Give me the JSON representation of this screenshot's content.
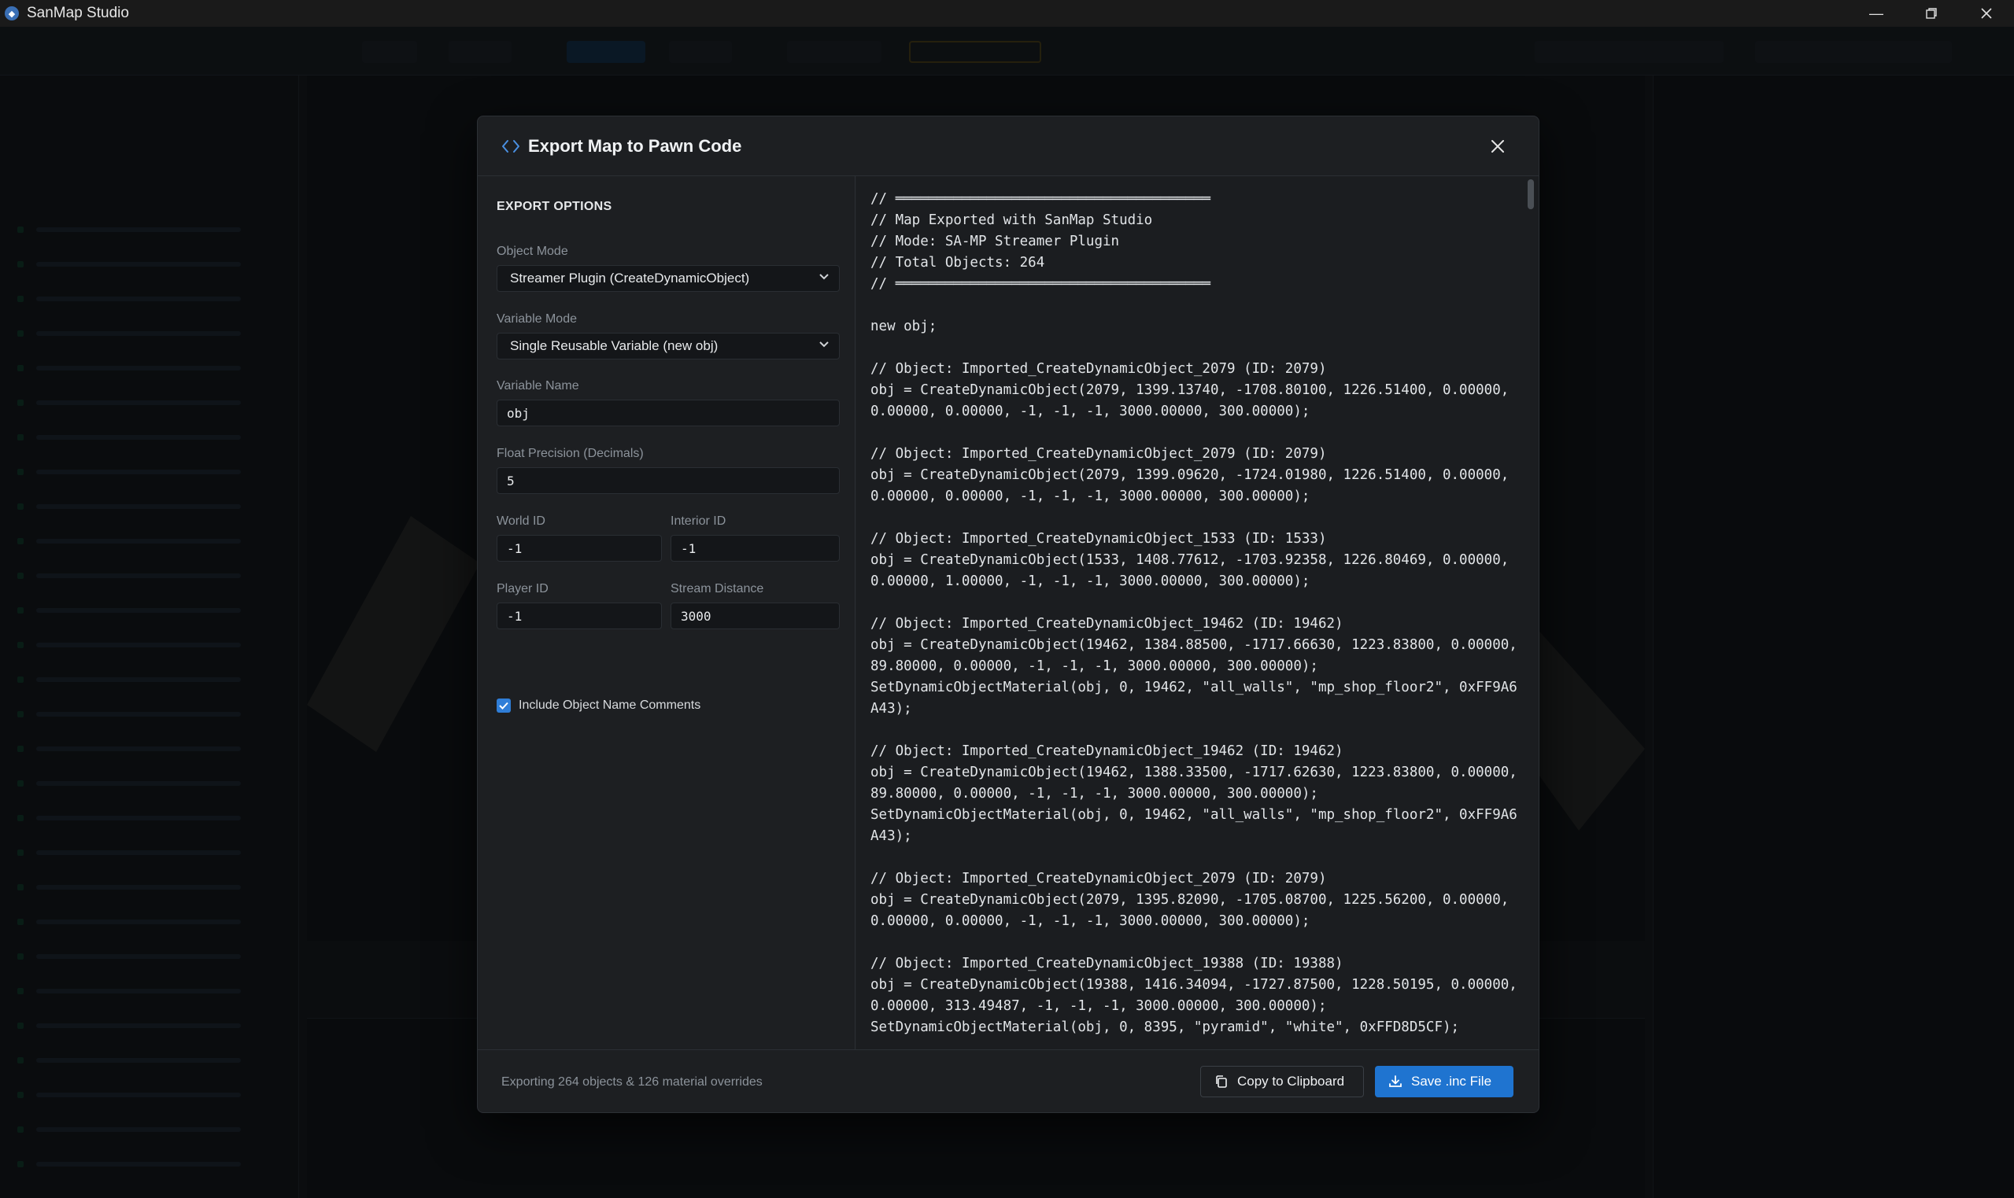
{
  "window": {
    "title": "SanMap Studio"
  },
  "dialog": {
    "title": "Export Map to Pawn Code",
    "options": {
      "section_title": "EXPORT OPTIONS",
      "object_mode": {
        "label": "Object Mode",
        "value": "Streamer Plugin (CreateDynamicObject)"
      },
      "variable_mode": {
        "label": "Variable Mode",
        "value": "Single Reusable Variable (new obj)"
      },
      "variable_name": {
        "label": "Variable Name",
        "value": "obj"
      },
      "float_precision": {
        "label": "Float Precision (Decimals)",
        "value": "5"
      },
      "world_id": {
        "label": "World ID",
        "value": "-1"
      },
      "interior_id": {
        "label": "Interior ID",
        "value": "-1"
      },
      "player_id": {
        "label": "Player ID",
        "value": "-1"
      },
      "stream_distance": {
        "label": "Stream Distance",
        "value": "3000"
      },
      "include_comments": {
        "label": "Include Object Name Comments",
        "checked": true
      }
    },
    "code": "// ══════════════════════════════════════\n// Map Exported with SanMap Studio\n// Mode: SA-MP Streamer Plugin\n// Total Objects: 264\n// ══════════════════════════════════════\n\nnew obj;\n\n// Object: Imported_CreateDynamicObject_2079 (ID: 2079)\nobj = CreateDynamicObject(2079, 1399.13740, -1708.80100, 1226.51400, 0.00000, 0.00000, 0.00000, -1, -1, -1, 3000.00000, 300.00000);\n\n// Object: Imported_CreateDynamicObject_2079 (ID: 2079)\nobj = CreateDynamicObject(2079, 1399.09620, -1724.01980, 1226.51400, 0.00000, 0.00000, 0.00000, -1, -1, -1, 3000.00000, 300.00000);\n\n// Object: Imported_CreateDynamicObject_1533 (ID: 1533)\nobj = CreateDynamicObject(1533, 1408.77612, -1703.92358, 1226.80469, 0.00000, 0.00000, 1.00000, -1, -1, -1, 3000.00000, 300.00000);\n\n// Object: Imported_CreateDynamicObject_19462 (ID: 19462)\nobj = CreateDynamicObject(19462, 1384.88500, -1717.66630, 1223.83800, 0.00000, 89.80000, 0.00000, -1, -1, -1, 3000.00000, 300.00000);\nSetDynamicObjectMaterial(obj, 0, 19462, \"all_walls\", \"mp_shop_floor2\", 0xFF9A6A43);\n\n// Object: Imported_CreateDynamicObject_19462 (ID: 19462)\nobj = CreateDynamicObject(19462, 1388.33500, -1717.62630, 1223.83800, 0.00000, 89.80000, 0.00000, -1, -1, -1, 3000.00000, 300.00000);\nSetDynamicObjectMaterial(obj, 0, 19462, \"all_walls\", \"mp_shop_floor2\", 0xFF9A6A43);\n\n// Object: Imported_CreateDynamicObject_2079 (ID: 2079)\nobj = CreateDynamicObject(2079, 1395.82090, -1705.08700, 1225.56200, 0.00000, 0.00000, 0.00000, -1, -1, -1, 3000.00000, 300.00000);\n\n// Object: Imported_CreateDynamicObject_19388 (ID: 19388)\nobj = CreateDynamicObject(19388, 1416.34094, -1727.87500, 1228.50195, 0.00000, 0.00000, 313.49487, -1, -1, -1, 3000.00000, 300.00000);\nSetDynamicObjectMaterial(obj, 0, 8395, \"pyramid\", \"white\", 0xFFD8D5CF);",
    "footer": {
      "status": "Exporting 264 objects & 126 material overrides",
      "copy_label": "Copy to Clipboard",
      "save_label": "Save .inc File"
    }
  },
  "colors": {
    "accent": "#1f74d0",
    "modal_bg": "#1d1f22",
    "titlebar_bg": "#1a1a1a"
  },
  "icons": {
    "app": "app-logo-icon",
    "minimize": "minimize-icon",
    "maximize": "restore-icon",
    "close": "close-icon",
    "dialog": "code-brackets-icon",
    "copy": "copy-icon",
    "save": "download-icon"
  }
}
